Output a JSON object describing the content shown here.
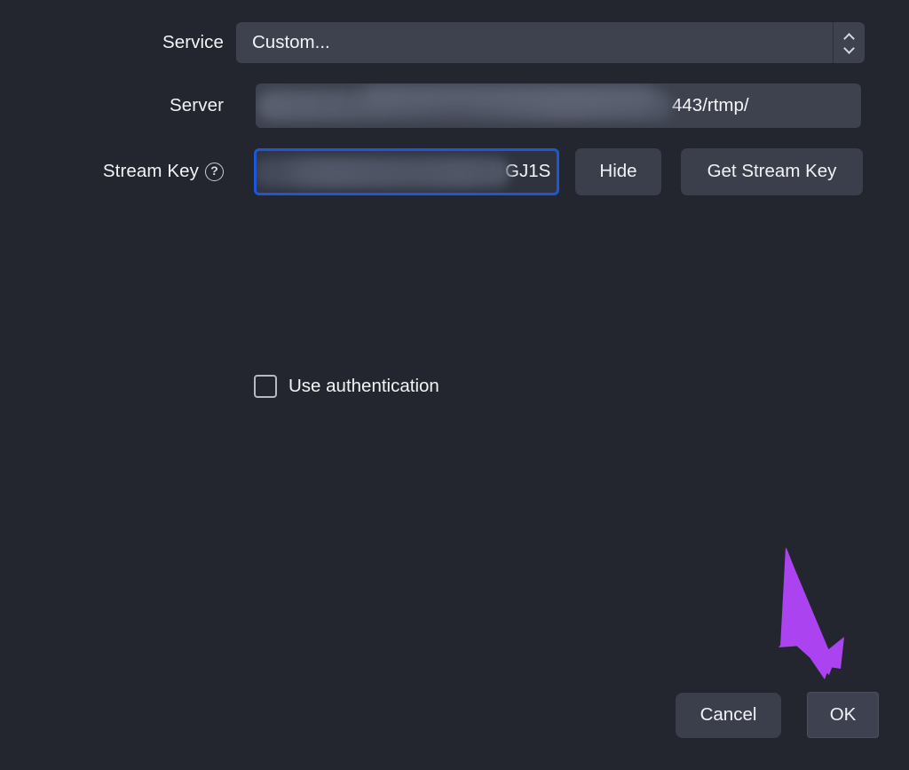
{
  "dialog": {
    "theme": {
      "background": "#23262e",
      "field_background": "#3e424f",
      "button_background": "#3b3f4c",
      "focus_border": "#1d56d6",
      "text": "#f2f3f5",
      "annotation_arrow": "#ab44f0"
    }
  },
  "fields": {
    "service": {
      "label": "Service",
      "value": "Custom...",
      "spinner_up_icon": "chevron-up-icon",
      "spinner_down_icon": "chevron-down-icon"
    },
    "server": {
      "label": "Server",
      "value": "443/rtmp/",
      "redacted": true
    },
    "stream_key": {
      "label": "Stream Key",
      "help_icon": "question-mark-help-icon",
      "help_glyph": "?",
      "value": "GJ1S",
      "redacted": true,
      "focused": true
    }
  },
  "buttons": {
    "hide": "Hide",
    "get_stream_key": "Get Stream Key",
    "cancel": "Cancel",
    "ok": "OK"
  },
  "auth": {
    "label": "Use authentication",
    "checked": false
  },
  "annotations": {
    "arrow": {
      "icon": "arrow-down-right-annotation",
      "points_to": "OK"
    }
  }
}
